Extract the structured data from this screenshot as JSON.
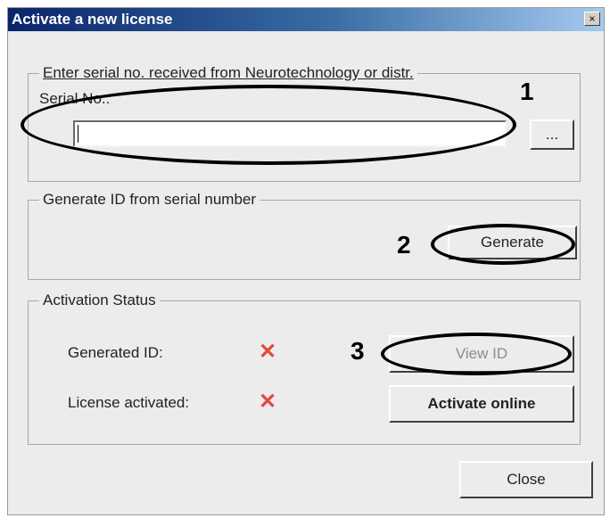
{
  "window": {
    "title": "Activate a new license",
    "close_glyph": "×"
  },
  "serial_group": {
    "legend": "Enter serial no. received from Neurotechnology or distr.",
    "serial_label": "Serial No.:",
    "serial_value": "",
    "browse_label": "..."
  },
  "generate_group": {
    "legend": "Generate ID from serial number",
    "generate_label": "Generate"
  },
  "status_group": {
    "legend": "Activation Status",
    "generated_id_label": "Generated ID:",
    "license_activated_label": "License activated:",
    "status_glyph": "✕",
    "status_color": "#e04a3a",
    "view_id_label": "View ID",
    "activate_online_label": "Activate online"
  },
  "footer": {
    "close_label": "Close"
  },
  "annotations": {
    "step1": "1",
    "step2": "2",
    "step3": "3"
  }
}
